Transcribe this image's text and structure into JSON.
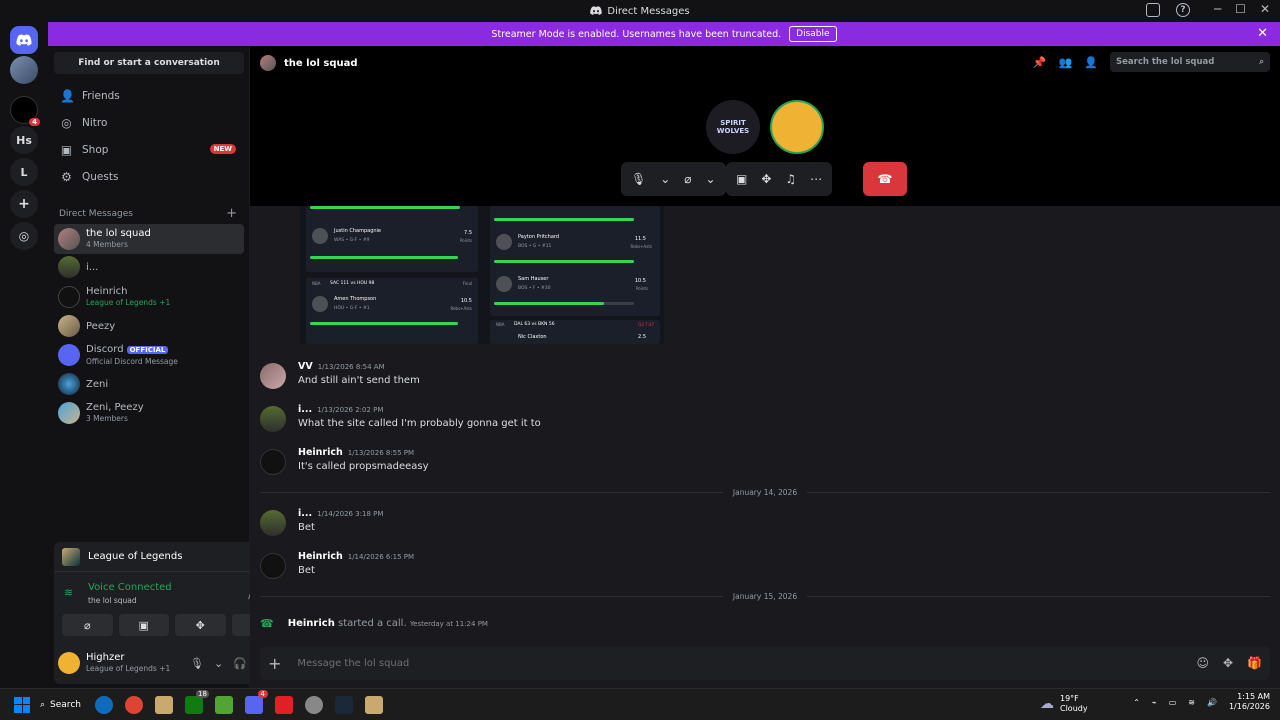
{
  "window": {
    "title": "Direct Messages"
  },
  "banner": {
    "text": "Streamer Mode is enabled. Usernames have been truncated.",
    "button": "Disable"
  },
  "servers": [
    {
      "label": "Hs"
    },
    {
      "label": "L"
    }
  ],
  "server_badges": {
    "notif": "4"
  },
  "sidebar": {
    "find": "Find or start a conversation",
    "nav": [
      {
        "label": "Friends",
        "icon": "friends-icon"
      },
      {
        "label": "Nitro",
        "icon": "nitro-icon"
      },
      {
        "label": "Shop",
        "icon": "shop-icon",
        "badge": "NEW"
      },
      {
        "label": "Quests",
        "icon": "quests-icon"
      }
    ],
    "dm_header": "Direct Messages",
    "dms": [
      {
        "name": "the lol squad",
        "sub": "4 Members"
      },
      {
        "name": "i...",
        "sub": ""
      },
      {
        "name": "Heinrich",
        "sub": "League of Legends +1"
      },
      {
        "name": "Peezy",
        "sub": ""
      },
      {
        "name": "Discord",
        "badge": "OFFICIAL",
        "sub": "Official Discord Message"
      },
      {
        "name": "Zeni",
        "sub": ""
      },
      {
        "name": "Zeni, Peezy",
        "sub": "3 Members"
      }
    ]
  },
  "activity": {
    "game": "League of Legends"
  },
  "voice": {
    "status": "Voice Connected",
    "channel": "the lol squad"
  },
  "user": {
    "name": "Highzer",
    "status": "League of Legends +1"
  },
  "channel": {
    "name": "the lol squad",
    "search_placeholder": "Search the lol squad"
  },
  "call_avatars": [
    {
      "text": "SPIRIT WOLVES"
    }
  ],
  "stats_image": {
    "rows": [
      {
        "name": "Justin Champagnie",
        "team": "WAS • G-F • #9",
        "line": "7.5",
        "stat": "Points"
      },
      {
        "name": "Payton Pritchard",
        "team": "BOS • G • #11",
        "line": "11.5",
        "stat": "Rebs+Asts"
      },
      {
        "name": "Sam Hauser",
        "team": "BOS • F • #30",
        "line": "10.5",
        "stat": "Points"
      },
      {
        "name": "Amen Thompson",
        "team": "HOU • G-F • #1",
        "line": "10.5",
        "stat": "Rebs+Asts"
      },
      {
        "name": "Nic Claxton",
        "team": "",
        "line": "2.5",
        "stat": ""
      }
    ],
    "game1": "SAC 111 vs HOU 98",
    "game1_status": "Final",
    "game2": "DAL 63 vs BKN 56",
    "game2_status": "Q3 7:47",
    "league": "NBA"
  },
  "messages": [
    {
      "author": "VV",
      "time": "1/13/2026 8:54 AM",
      "text": "And still ain't send them"
    },
    {
      "author": "i...",
      "time": "1/13/2026 2:02 PM",
      "text": "What the site called I'm probably gonna get it to"
    },
    {
      "author": "Heinrich",
      "time": "1/13/2026 8:55 PM",
      "text": "It's called propsmadeeasy"
    },
    {
      "author": "i...",
      "time": "1/14/2026 3:18 PM",
      "text": "Bet"
    },
    {
      "author": "Heinrich",
      "time": "1/14/2026 6:15 PM",
      "text": "Bet"
    }
  ],
  "dividers": [
    "January 14, 2026",
    "January 15, 2026"
  ],
  "call_event": {
    "author": "Heinrich",
    "text": "started a call.",
    "time": "Yesterday at 11:24 PM"
  },
  "input": {
    "placeholder": "Message the lol squad"
  },
  "taskbar": {
    "search": "Search",
    "badge1": "4",
    "badge2": "18",
    "weather_temp": "19°F",
    "weather_desc": "Cloudy",
    "time": "1:15 AM",
    "date": "1/16/2026"
  },
  "colors": {
    "accent": "#5865f2",
    "banner": "#8a2be2",
    "green": "#23a55a",
    "danger": "#da373c"
  }
}
